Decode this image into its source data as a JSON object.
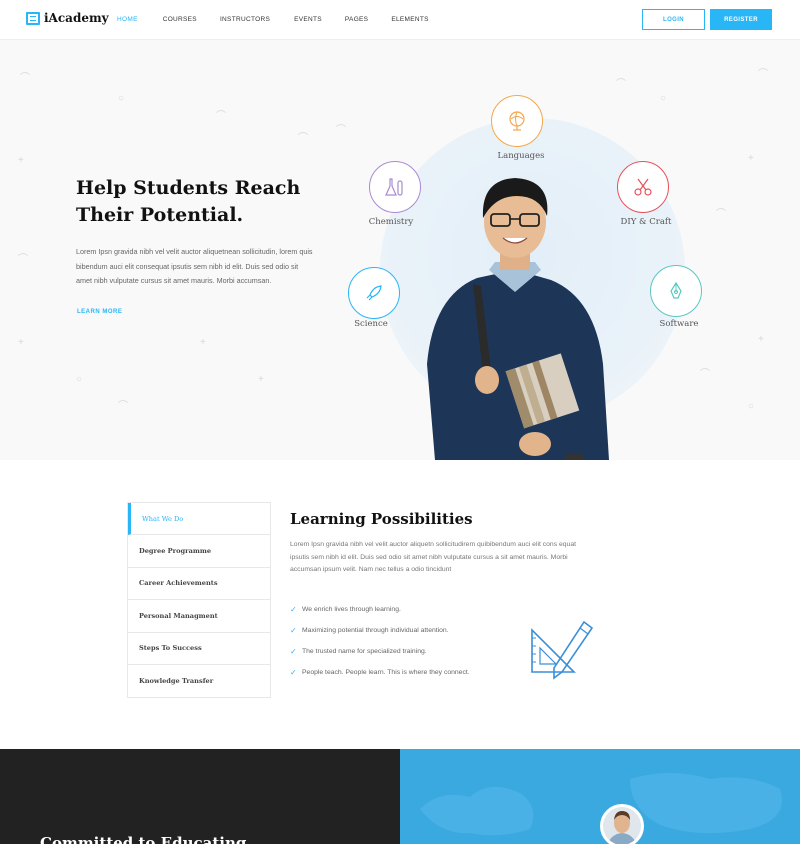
{
  "header": {
    "logo_text": "iAcademy",
    "nav": [
      "HOME",
      "COURSES",
      "INSTRUCTORS",
      "EVENTS",
      "PAGES",
      "ELEMENTS"
    ],
    "login_label": "LOGIN",
    "register_label": "REGISTER"
  },
  "hero": {
    "title_line1": "Help Students Reach",
    "title_line2": "Their Potential.",
    "text": "Lorem Ipsn gravida nibh vel velit auctor aliquetnean sollicitudin, lorem quis bibendum auci elit consequat ipsutis sem nibh id elit. Duis sed odio sit amet nibh vulputate cursus sit amet mauris. Morbi accumsan.",
    "link_label": "LEARN MORE",
    "subjects": [
      "Languages",
      "Chemistry",
      "DIY & Craft",
      "Science",
      "Software"
    ]
  },
  "section2": {
    "tabs": [
      "What We Do",
      "Degree Programme",
      "Career Achievements",
      "Personal Managment",
      "Steps To Success",
      "Knowledge Transfer"
    ],
    "title": "Learning Possibilities",
    "text": "Lorem Ipsn gravida nibh vel velit auctor aliquetn sollicitudirem quibibendum auci elit cons equat ipsutis sem nibh id elit. Duis sed odio sit amet nibh vulputate cursus a sit amet mauris. Morbi accumsan ipsum velit. Nam nec tellus a odio tincidunt",
    "checks": [
      "We enrich lives through learning.",
      "Maximizing potential through individual attention.",
      "The trusted name for specialized training.",
      "People teach. People learn. This is where they connect."
    ]
  },
  "bottom": {
    "title": "Committed to Educating"
  },
  "colors": {
    "accent": "#29b6f6",
    "dark": "#222222",
    "blue": "#3aa9e0",
    "orange": "#f5a64a",
    "purple": "#a98bd0",
    "red": "#e8505b",
    "teal": "#58c8c0"
  }
}
